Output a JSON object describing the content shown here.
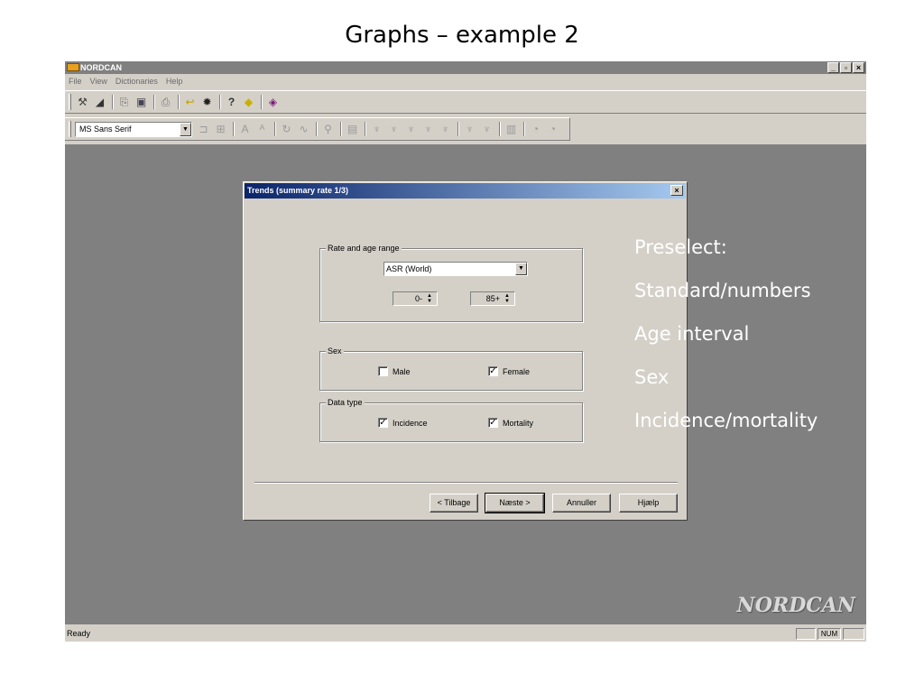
{
  "slide": {
    "title": "Graphs – example 2"
  },
  "app": {
    "title": "NORDCAN",
    "window_controls": [
      "_",
      "̅",
      "x"
    ],
    "menu": [
      "File",
      "View",
      "Dictionaries",
      "Help"
    ],
    "font_combo": "MS Sans Serif",
    "watermark": "NORDCAN",
    "status": {
      "text": "Ready",
      "num": "NUM"
    }
  },
  "dialog": {
    "title": "Trends (summary rate 1/3)",
    "close": "x",
    "rate_group": {
      "label": "Rate and age range",
      "selected": "ASR (World)",
      "age_from": "0-",
      "age_to": "85+"
    },
    "sex_group": {
      "label": "Sex",
      "male": {
        "label": "Male",
        "checked": false
      },
      "female": {
        "label": "Female",
        "checked": true
      }
    },
    "datatype_group": {
      "label": "Data type",
      "incidence": {
        "label": "Incidence",
        "checked": true
      },
      "mortality": {
        "label": "Mortality",
        "checked": true
      }
    },
    "buttons": {
      "back": "< Tilbage",
      "next": "Næste >",
      "cancel": "Annuller",
      "help": "Hjælp"
    }
  },
  "notes": [
    "Preselect:",
    "Standard/numbers",
    "Age interval",
    "Sex",
    "Incidence/mortality"
  ]
}
